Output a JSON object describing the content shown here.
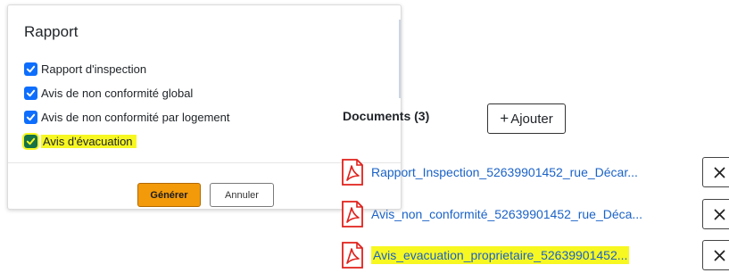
{
  "report_dialog": {
    "title": "Rapport",
    "options": [
      {
        "label": "Rapport d'inspection",
        "checked": true
      },
      {
        "label": "Avis de non conformité global",
        "checked": true
      },
      {
        "label": "Avis de non conformité par logement",
        "checked": true
      },
      {
        "label": "Avis d'évacuation",
        "checked": true,
        "highlighted": true
      }
    ],
    "generate_label": "Générer",
    "cancel_label": "Annuler"
  },
  "documents": {
    "title": "Documents (3)",
    "add_label": "Ajouter",
    "items": [
      {
        "name": "Rapport_Inspection_52639901452_rue_Décar...",
        "icon": "pdf-icon"
      },
      {
        "name": "Avis_non_conformité_52639901452_rue_Déca...",
        "icon": "pdf-icon"
      },
      {
        "name": "Avis_evacuation_proprietaire_52639901452...",
        "icon": "pdf-icon",
        "highlighted": true
      }
    ],
    "remove_icon": "close-icon"
  },
  "colors": {
    "primary_checkbox": "#0d6efd",
    "generate_button": "#f39a0a",
    "link": "#1a62c7",
    "pdf_red": "#e0201b",
    "highlight": "#f7f722"
  }
}
